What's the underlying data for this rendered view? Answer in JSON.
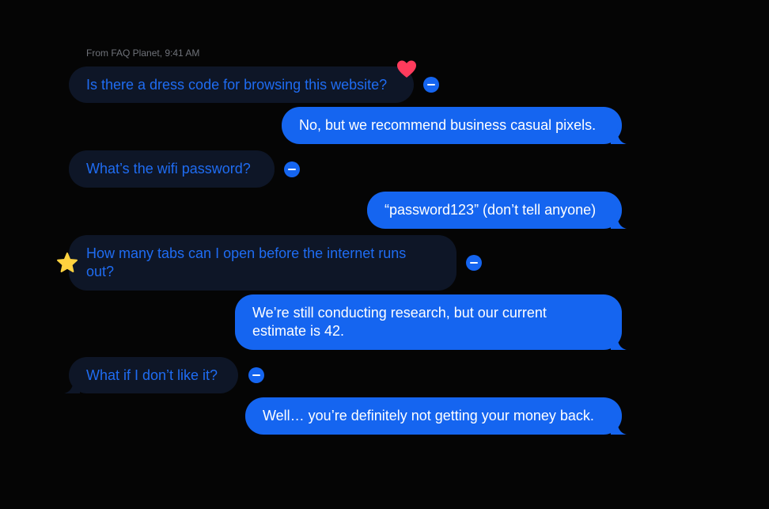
{
  "header": {
    "meta": "From FAQ Planet, 9:41 AM"
  },
  "messages": [
    {
      "text": "Is there a dress code for browsing this website?"
    },
    {
      "text": "No, but we recommend business casual pixels."
    },
    {
      "text": "What’s the wifi password?"
    },
    {
      "text": "“password123” (don’t tell anyone)"
    },
    {
      "text": "How many tabs can I open before the internet runs out?"
    },
    {
      "text": "We’re still conducting research, but our current estimate is 42."
    },
    {
      "text": "What if I don’t like it?"
    },
    {
      "text": "Well… you’re definitely not getting your money back."
    }
  ],
  "colors": {
    "background": "#050505",
    "incoming_bubble": "#0e1627",
    "incoming_text": "#1f6cf2",
    "outgoing_bubble": "#1565f0",
    "outgoing_text": "#ffffff",
    "heart": "#ff3b5c",
    "star": "#ffd23f"
  },
  "icons": {
    "heart_reaction": "heart-icon",
    "star_reaction": "star-icon",
    "remove_button": "minus-circle-icon"
  }
}
